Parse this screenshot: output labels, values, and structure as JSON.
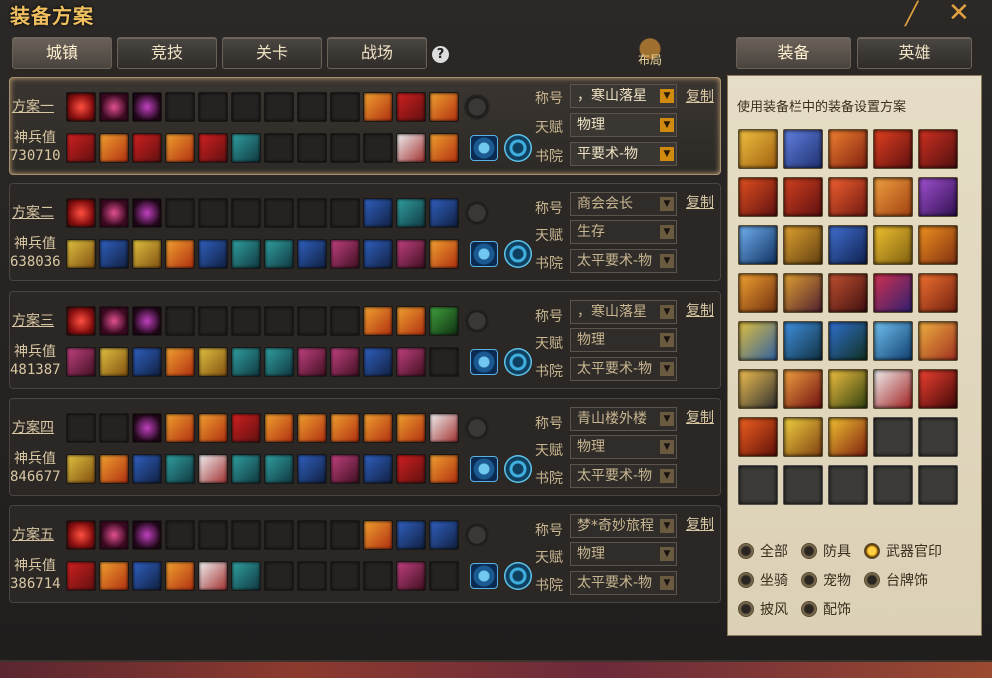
{
  "title": "装备方案",
  "tabs": [
    {
      "label": "城镇",
      "active": true
    },
    {
      "label": "竞技",
      "active": false
    },
    {
      "label": "关卡",
      "active": false
    },
    {
      "label": "战场",
      "active": false
    }
  ],
  "help_label": "?",
  "layout_label": "布局",
  "right_tabs": [
    "装备",
    "英雄"
  ],
  "labels": {
    "power": "神兵值",
    "title_label": "称号",
    "talent_label": "天赋",
    "academy_label": "书院",
    "copy": "复制",
    "dropdown_arrow": "▼"
  },
  "plans": [
    {
      "name": "方案一",
      "power": "730710",
      "title": "，寒山落星",
      "talent": "物理",
      "academy": "平要术-物",
      "active": true
    },
    {
      "name": "方案二",
      "power": "638036",
      "title": "商会会长",
      "talent": "生存",
      "academy": "太平要术-物",
      "active": false
    },
    {
      "name": "方案三",
      "power": "481387",
      "title": "，寒山落星",
      "talent": "物理",
      "academy": "太平要术-物",
      "active": false
    },
    {
      "name": "方案四",
      "power": "846677",
      "title": "青山楼外楼",
      "talent": "物理",
      "academy": "太平要术-物",
      "active": false
    },
    {
      "name": "方案五",
      "power": "386714",
      "title": "梦*奇妙旅程",
      "talent": "物理",
      "academy": "太平要术-物",
      "active": false
    }
  ],
  "side_description": "使用装备栏中的装备设置方案",
  "filters": [
    {
      "label": "全部",
      "selected": false
    },
    {
      "label": "防具",
      "selected": false
    },
    {
      "label": "武器官印",
      "selected": true
    },
    {
      "label": "坐骑",
      "selected": false
    },
    {
      "label": "宠物",
      "selected": false
    },
    {
      "label": "台牌饰",
      "selected": false
    },
    {
      "label": "披风",
      "selected": false
    },
    {
      "label": "配饰",
      "selected": false
    }
  ],
  "colors": {
    "accent": "#f0c060",
    "panel_bg": "#e6ddc6",
    "selected_radio": "#ffd040"
  }
}
